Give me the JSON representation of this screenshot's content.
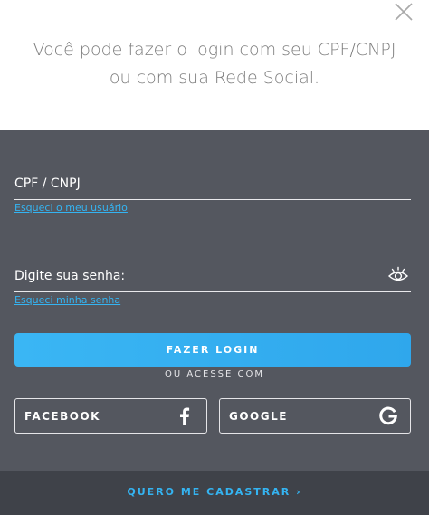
{
  "header": {
    "headline_line1": "Você pode fazer o login com seu CPF/CNPJ",
    "headline_line2": "ou com sua Rede Social.",
    "close_icon": "close-icon"
  },
  "form": {
    "cpf_label": "CPF / CNPJ",
    "forgot_user": "Esqueci o meu usuário",
    "password_label": "Digite sua senha:",
    "forgot_password": "Esqueci minha senha",
    "eye_icon": "eye-icon"
  },
  "actions": {
    "login_label": "FAZER LOGIN",
    "or_text": "OU ACESSE COM",
    "facebook_label": "FACEBOOK",
    "google_label": "GOOGLE"
  },
  "footer": {
    "register_label": "QUERO ME CADASTRAR ›"
  },
  "colors": {
    "accent": "#34b4f2",
    "panel": "#54575f",
    "footer": "#3f4249"
  }
}
